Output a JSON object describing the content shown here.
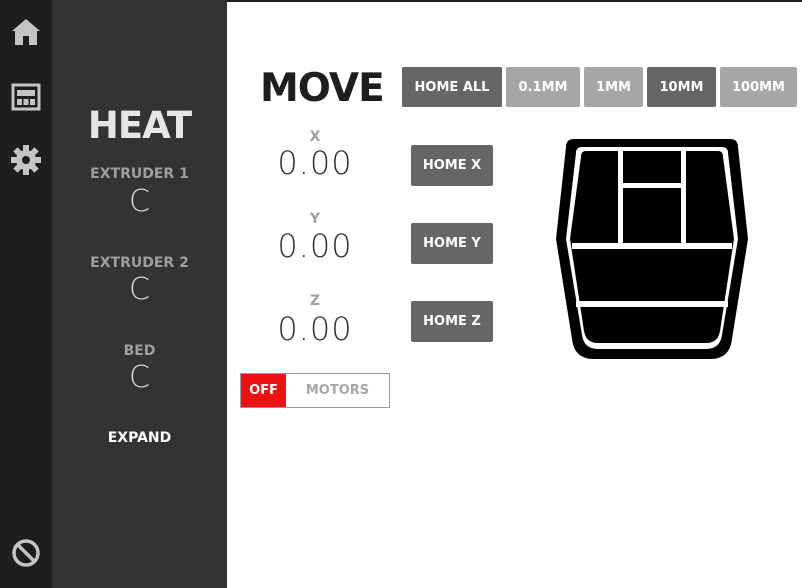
{
  "nav": {
    "home_icon": "home-icon",
    "display_icon": "display-icon",
    "settings_icon": "gear-icon",
    "stop_icon": "stop-icon"
  },
  "heat": {
    "title": "HEAT",
    "extruder1": {
      "label": "EXTRUDER 1",
      "value": "C"
    },
    "extruder2": {
      "label": "EXTRUDER 2",
      "value": "C"
    },
    "bed": {
      "label": "BED",
      "value": "C"
    },
    "expand_label": "EXPAND"
  },
  "move": {
    "title": "MOVE",
    "home_all": "HOME ALL",
    "steps": [
      {
        "label": "0.1MM",
        "selected": false
      },
      {
        "label": "1MM",
        "selected": false
      },
      {
        "label": "10MM",
        "selected": true
      },
      {
        "label": "100MM",
        "selected": false
      }
    ],
    "axes": [
      {
        "label": "X",
        "value": "0.00",
        "home_label": "HOME X"
      },
      {
        "label": "Y",
        "value": "0.00",
        "home_label": "HOME Y"
      },
      {
        "label": "Z",
        "value": "0.00",
        "home_label": "HOME Z"
      }
    ],
    "motors": {
      "state": "OFF",
      "label": "MOTORS"
    }
  },
  "colors": {
    "sidebar": "#1d1d1d",
    "heat_panel": "#333333",
    "button_dark": "#666666",
    "button_light": "#a6a6a6",
    "motors_off": "#ee1111"
  }
}
